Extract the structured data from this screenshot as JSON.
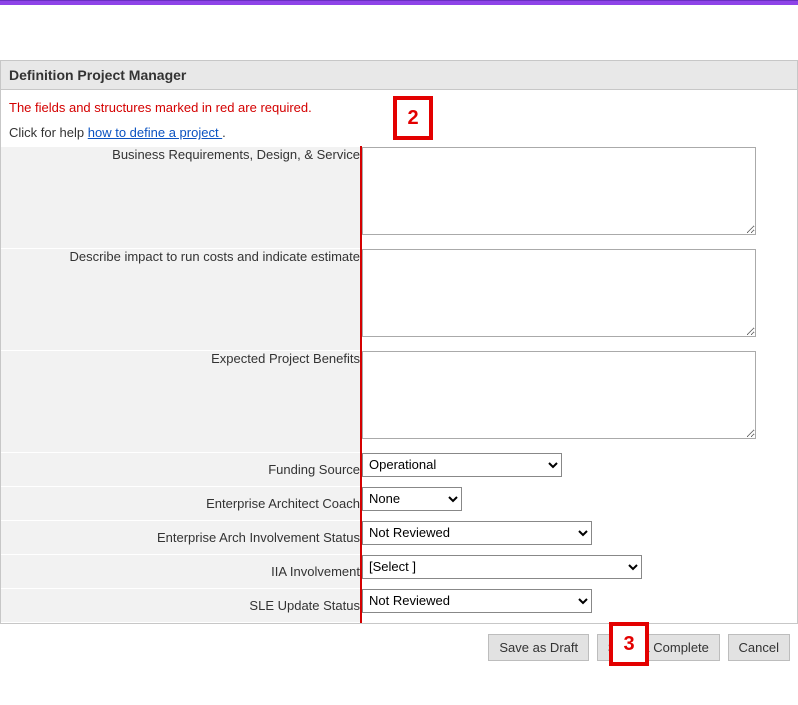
{
  "panel": {
    "title": "Definition Project Manager"
  },
  "messages": {
    "required": "The fields and structures marked in red are required.",
    "help_prefix": "Click for help ",
    "help_link_text": "how to define a project ",
    "help_suffix": "."
  },
  "fields": {
    "biz_req": {
      "label": "Business Requirements, Design, & Service",
      "value": ""
    },
    "run_cost": {
      "label": "Describe impact to run costs and indicate estimate",
      "value": ""
    },
    "benefits": {
      "label": "Expected Project Benefits",
      "value": ""
    },
    "funding": {
      "label": "Funding Source",
      "selected": "Operational"
    },
    "coach": {
      "label": "Enterprise Architect Coach",
      "selected": "None"
    },
    "ea_status": {
      "label": "Enterprise Arch Involvement Status",
      "selected": "Not Reviewed"
    },
    "iia": {
      "label": "IIA Involvement",
      "selected": "[Select ]"
    },
    "sle": {
      "label": "SLE Update Status",
      "selected": "Not Reviewed"
    }
  },
  "buttons": {
    "save_draft": "Save as Draft",
    "save_complete": "Save & Complete",
    "cancel": "Cancel"
  },
  "callouts": {
    "c2": "2",
    "c3": "3"
  }
}
